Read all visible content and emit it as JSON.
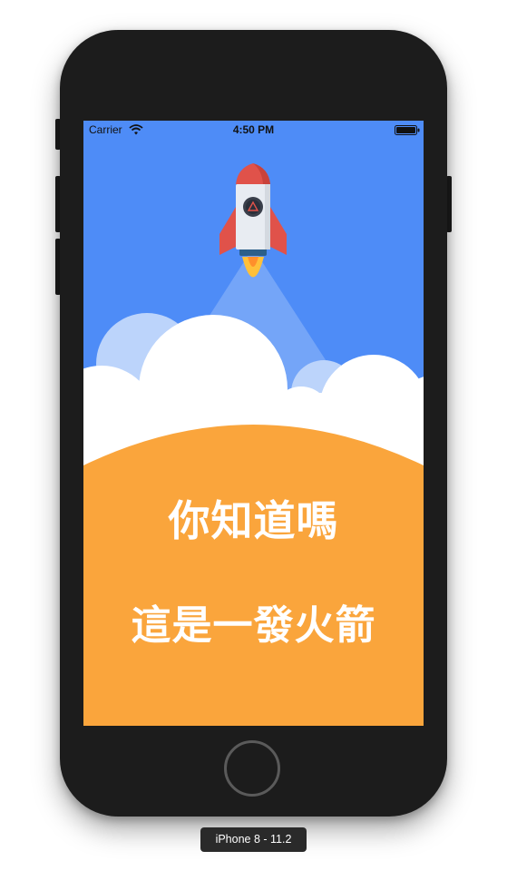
{
  "status_bar": {
    "carrier": "Carrier",
    "time": "4:50 PM",
    "wifi_icon": "wifi-icon",
    "battery_icon": "battery-icon"
  },
  "screen": {
    "background_color": "#4e8cf7",
    "rocket_icon": "rocket-icon",
    "cloud_color": "#ffffff",
    "ground_color": "#faa53c",
    "headline": "你知道嗎",
    "subline": "這是一發火箭"
  },
  "device": {
    "label": "iPhone 8 - 11.2",
    "home_button_icon": "home-button"
  }
}
